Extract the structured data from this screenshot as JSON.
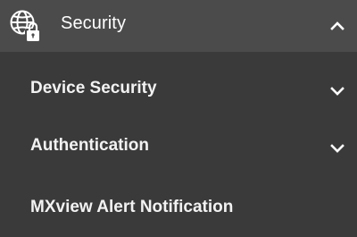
{
  "section": {
    "title": "Security",
    "icon": "globe-lock-icon",
    "expanded": true
  },
  "items": [
    {
      "label": "Device Security",
      "icon": "chevron-down-icon"
    },
    {
      "label": "Authentication",
      "icon": "chevron-down-icon"
    },
    {
      "label": "MXview Alert Notification"
    }
  ],
  "colors": {
    "background": "#3a3a3a",
    "header_background": "#4b4b4b",
    "text": "#ffffff"
  }
}
